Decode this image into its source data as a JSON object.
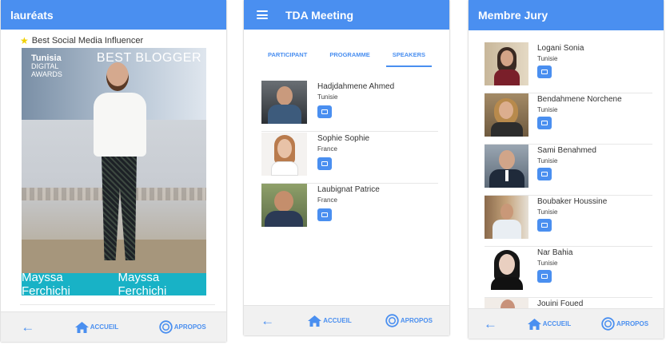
{
  "panel1": {
    "title": "lauréats",
    "award": "Best Social Media Influencer",
    "photo_text": {
      "brand_line1": "Tunisia",
      "brand_line2": "DIGITAL",
      "brand_line3": "AWARDS",
      "headline": "BEST BLOGGER",
      "caption_left": "Mayssa Ferchichi",
      "caption_right": "Mayssa Ferchichi"
    }
  },
  "panel2": {
    "title": "TDA Meeting",
    "tabs": [
      "PARTICIPANT",
      "PROGRAMME",
      "SPEAKERS"
    ],
    "active_tab": "SPEAKERS",
    "speakers": [
      {
        "name": "Hadjdahmene Ahmed",
        "country": "Tunisie"
      },
      {
        "name": "Sophie Sophie",
        "country": "France"
      },
      {
        "name": "Laubignat Patrice",
        "country": "France"
      }
    ]
  },
  "panel3": {
    "title": "Membre Jury",
    "members": [
      {
        "name": "Logani Sonia",
        "country": "Tunisie"
      },
      {
        "name": "Bendahmene Norchene",
        "country": "Tunisie"
      },
      {
        "name": "Sami Benahmed",
        "country": "Tunisie"
      },
      {
        "name": "Boubaker Houssine",
        "country": "Tunisie"
      },
      {
        "name": "Nar Bahia",
        "country": "Tunisie"
      },
      {
        "name": "Jouini Foued",
        "country": ""
      }
    ]
  },
  "nav": {
    "back_icon": "arrow-left-icon",
    "home_label": "ACCUEIL",
    "home_icon": "home-icon",
    "about_label": "APROPOS",
    "about_icon": "info-circle-icon"
  },
  "colors": {
    "primary": "#4a8ff0",
    "caption_band": "#18b2c6",
    "star": "#f0d000"
  }
}
